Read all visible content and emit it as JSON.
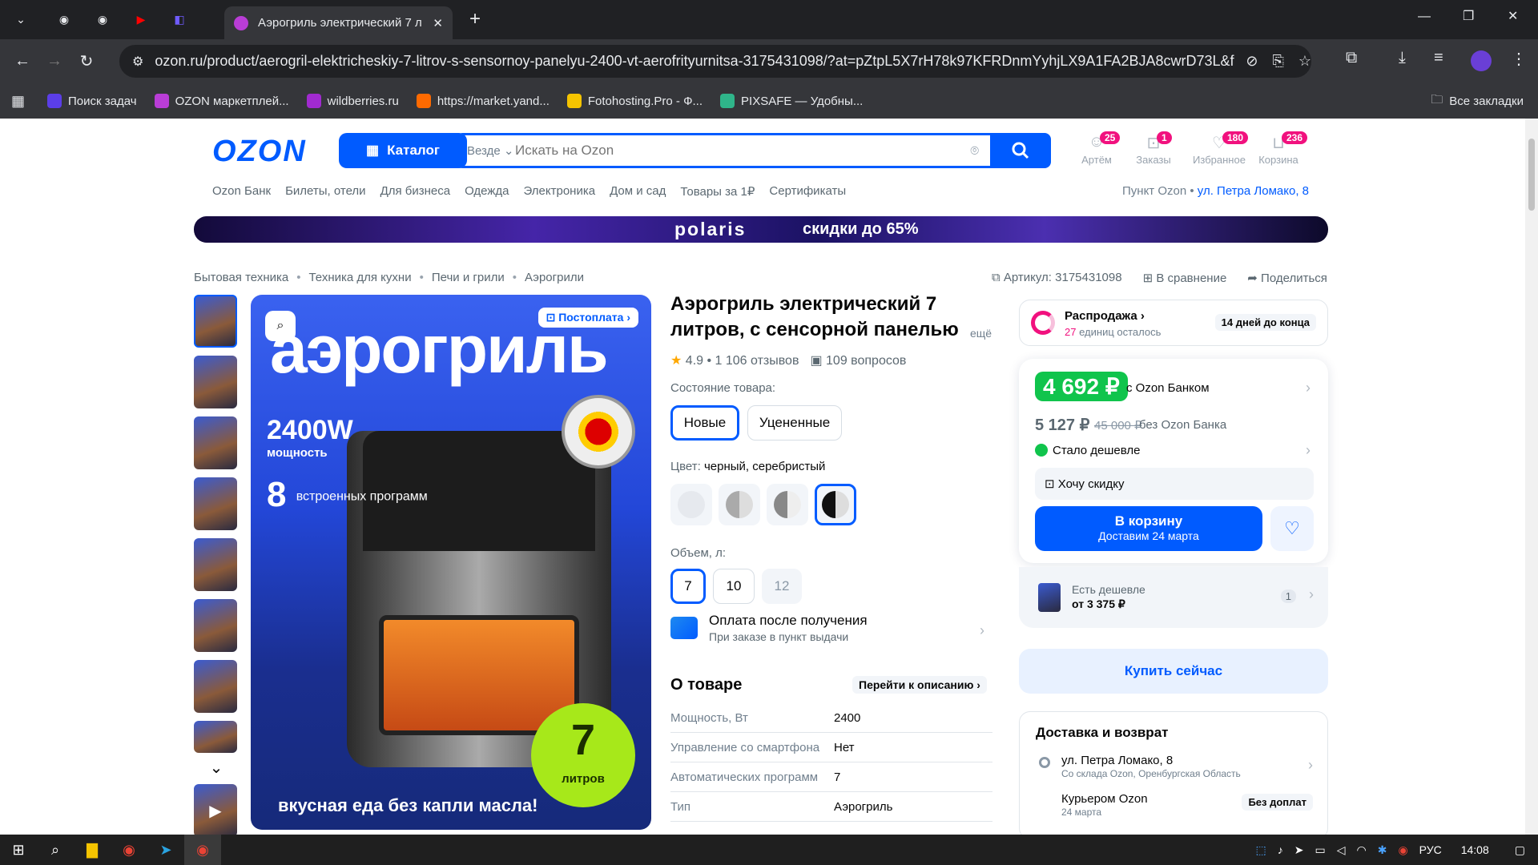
{
  "browser": {
    "tab_title": "Аэрогриль электрический 7 л",
    "new_tab_symbol": "+",
    "url": "ozon.ru/product/aerogril-elektricheskiy-7-litrov-s-sensornoy-panelyu-2400-vt-aerofrityurnitsa-3175431098/?at=pZtpL5X7rH78k97KFRDnmYyhjLX9A1FA2BJA8cwrD73L&fr...",
    "bookmarks": [
      {
        "label": "Поиск задач",
        "color": "#5b3ee8"
      },
      {
        "label": "OZON маркетплей...",
        "color": "#b93dd6"
      },
      {
        "label": "wildberries.ru",
        "color": "#a12ad0"
      },
      {
        "label": "https://market.yand...",
        "color": "#ff6a00"
      },
      {
        "label": "Fotohosting.Pro - Ф...",
        "color": "#f5c400"
      },
      {
        "label": "PIXSAFE — Удобны...",
        "color": "#2fb58a"
      }
    ],
    "all_bookmarks": "Все закладки"
  },
  "header": {
    "logo": "OZON",
    "catalog": "Каталог",
    "search_scope": "Везде",
    "search_placeholder": "Искать на Ozon",
    "icons": [
      {
        "label": "Артём",
        "badge": "25"
      },
      {
        "label": "Заказы",
        "badge": "1"
      },
      {
        "label": "Избранное",
        "badge": "180"
      },
      {
        "label": "Корзина",
        "badge": "236"
      }
    ],
    "subnav": [
      "Ozon Банк",
      "Билеты, отели",
      "Для бизнеса",
      "Одежда",
      "Электроника",
      "Дом и сад",
      "Товары за 1₽",
      "Сертификаты"
    ],
    "pickup_label": "Пункт Ozon •",
    "pickup_address": "ул. Петра Ломако, 8"
  },
  "banner": {
    "brand": "polaris",
    "promo": "скидки до 65%"
  },
  "breadcrumbs": [
    "Бытовая техника",
    "Техника для кухни",
    "Печи и грили",
    "Аэрогрили"
  ],
  "meta": {
    "sku": "Артикул: 3175431098",
    "compare": "В сравнение",
    "share": "Поделиться"
  },
  "product": {
    "title": "Аэрогриль электрический 7 литров, с сенсорной панелью",
    "more": "ещё",
    "rating": "4.9 • 1 106 отзывов",
    "questions": "109 вопросов",
    "image": {
      "postoplata": "Постоплата",
      "headline": "аэрогриль",
      "power": "2400W",
      "power_sub": "мощность",
      "programs_num": "8",
      "programs_sub": "встроенных программ",
      "liters_num": "7",
      "liters_sub": "литров",
      "tagline": "вкусная еда без капли масла!"
    },
    "condition_label": "Состояние товара:",
    "conditions": [
      "Новые",
      "Уцененные"
    ],
    "color_label": "Цвет:",
    "color_value": "черный, серебристый",
    "volume_label": "Объем, л:",
    "volumes": [
      "7",
      "10",
      "12"
    ],
    "pay_after": "Оплата после получения",
    "pay_after_sub": "При заказе в пункт выдачи",
    "about": "О товаре",
    "to_description": "Перейти к описанию",
    "specs": [
      {
        "k": "Мощность, Вт",
        "v": "2400"
      },
      {
        "k": "Управление со смартфона",
        "v": "Нет"
      },
      {
        "k": "Автоматических программ",
        "v": "7"
      },
      {
        "k": "Тип",
        "v": "Аэрогриль"
      }
    ]
  },
  "offer": {
    "sale_title": "Распродажа",
    "sale_units": "27",
    "sale_units_suffix": "единиц осталось",
    "sale_days": "14 дней до конца",
    "price_bank": "4 692 ₽",
    "with_bank": "с Ozon Банком",
    "price": "5 127 ₽",
    "old_price": "45 000 ₽",
    "without_bank": "без Ozon Банка",
    "cheaper": "Стало дешевле",
    "want_discount": "Хочу скидку",
    "to_cart": "В корзину",
    "to_cart_sub": "Доставим 24 марта",
    "cheaper_alt": "Есть дешевле",
    "cheaper_alt_price": "от 3 375 ₽",
    "cheaper_alt_count": "1",
    "buy_now": "Купить сейчас",
    "delivery_title": "Доставка и возврат",
    "delivery_address": "ул. Петра Ломако, 8",
    "delivery_address_sub": "Со склада Ozon, Оренбургская Область",
    "courier": "Курьером Ozon",
    "courier_date": "24 марта",
    "no_extra": "Без доплат"
  },
  "taskbar": {
    "lang": "РУС",
    "time": "14:08"
  }
}
